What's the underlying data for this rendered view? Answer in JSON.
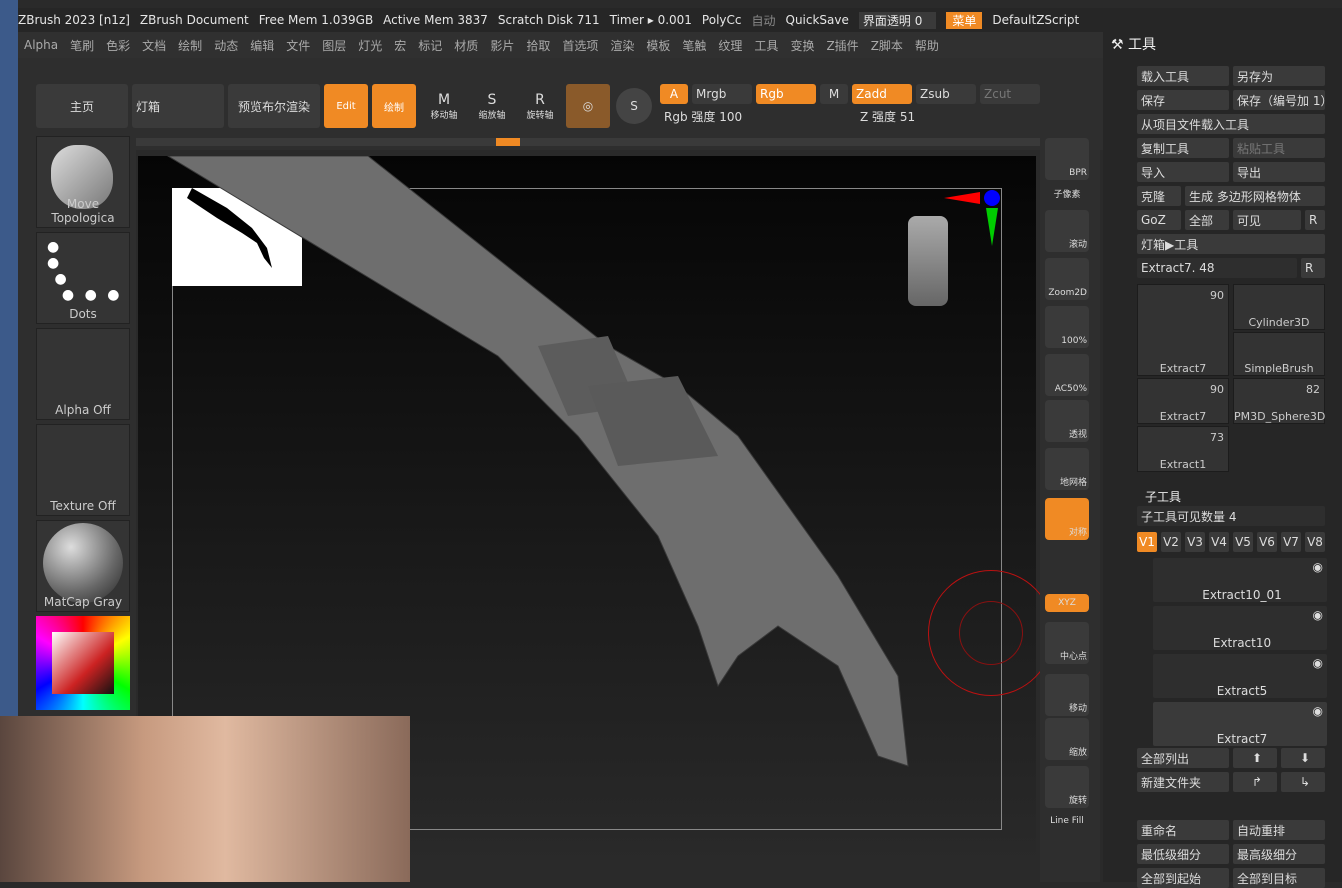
{
  "titlebar": {
    "app": "ZBrush 2023 [n1z]",
    "doc": "ZBrush Document",
    "freemem": "Free Mem 1.039GB",
    "activemem": "Active Mem 3837",
    "scratch": "Scratch Disk 711",
    "timer": "Timer ▸ 0.001",
    "polyc": "PolyCc",
    "auto": "自动",
    "quicksave": "QuickSave",
    "transp": "界面透明 0",
    "menu": "菜单",
    "script": "DefaultZScript"
  },
  "menus": [
    "Alpha",
    "笔刷",
    "色彩",
    "文档",
    "绘制",
    "动态",
    "编辑",
    "文件",
    "图层",
    "灯光",
    "宏",
    "标记",
    "材质",
    "影片",
    "拾取",
    "首选项",
    "渲染",
    "模板",
    "笔触",
    "纹理",
    "工具",
    "变换",
    "Z插件",
    "Z脚本",
    "帮助"
  ],
  "shelf": {
    "home": "主页",
    "lightbox": "灯箱",
    "bpr": "预览布尔渲染",
    "edit": "Edit",
    "draw": "绘制",
    "move": "移动轴",
    "scale": "缩放轴",
    "rotate": "旋转轴",
    "a": "A",
    "mrgb": "Mrgb",
    "rgb": "Rgb",
    "m": "M",
    "zadd": "Zadd",
    "zsub": "Zsub",
    "zcut": "Zcut",
    "rgb_int": "Rgb 强度 100",
    "z_int": "Z 强度 51"
  },
  "left": {
    "brush": "Move Topologica",
    "stroke": "Dots",
    "alpha": "Alpha Off",
    "texture": "Texture Off",
    "material": "MatCap Gray"
  },
  "right": [
    "BPR",
    "子像素",
    "滚动",
    "Zoom2D",
    "100%",
    "AC50%",
    "透视",
    "地网格",
    "对称",
    "XYZ",
    "中心点",
    "移动",
    "缩放",
    "旋转",
    "Line Fill"
  ],
  "panel": {
    "title": "工具",
    "load": "载入工具",
    "saveas": "另存为",
    "save": "保存",
    "saveinc": "保存（编号加 1）",
    "loadproj": "从项目文件载入工具",
    "copy": "复制工具",
    "paste": "粘贴工具",
    "import": "导入",
    "export": "导出",
    "clone": "克隆",
    "polymesh": "生成 多边形网格物体",
    "goz": "GoZ",
    "all": "全部",
    "visible": "可见",
    "r": "R",
    "lightboxtool": "灯箱▶工具",
    "extract": "Extract7. 48",
    "thumbs": [
      {
        "name": "Extract7",
        "n": "90"
      },
      {
        "name": "Cylinder3D",
        "n": ""
      },
      {
        "name": "SimpleBrush",
        "n": ""
      },
      {
        "name": "Extract7",
        "n": "90"
      },
      {
        "name": "PM3D_Sphere3D",
        "n": "82"
      },
      {
        "name": "Extract1",
        "n": "73"
      }
    ],
    "subtool": "子工具",
    "subcount": "子工具可见数量 4",
    "v": [
      "V1",
      "V2",
      "V3",
      "V4",
      "V5",
      "V6",
      "V7",
      "V8"
    ],
    "subtools": [
      "Extract10_01",
      "Extract10",
      "Extract5",
      "Extract7"
    ],
    "listall": "全部列出",
    "newfolder": "新建文件夹",
    "rename": "重命名",
    "autoorder": "自动重排",
    "lowest": "最低级细分",
    "highest": "最高级细分",
    "toStart": "全部到起始",
    "toTarget": "全部到目标"
  }
}
